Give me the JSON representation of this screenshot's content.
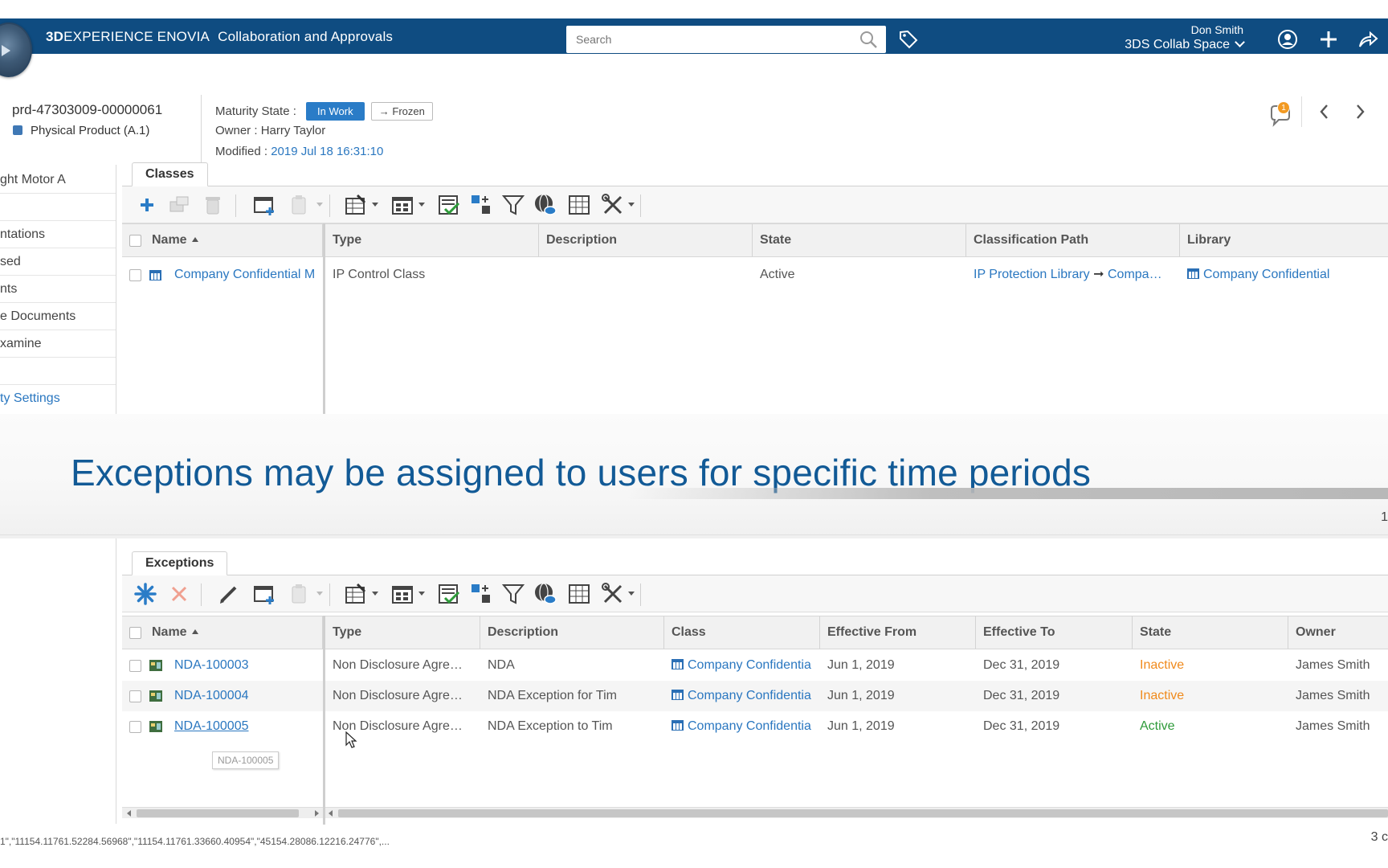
{
  "app": {
    "brand_bold": "3D",
    "brand_main": "EXPERIENCE ENOVIA",
    "brand_sub": "Collaboration and Approvals",
    "search_placeholder": "Search",
    "user_name": "Don Smith",
    "collab_space": "3DS Collab Space",
    "accent": "#0f4c81"
  },
  "header": {
    "object_id": "prd-47303009-00000061",
    "object_type": "Physical Product (A.1)",
    "maturity_label": "Maturity State :",
    "state_current": "In Work",
    "state_next": "Frozen",
    "owner_label": "Owner :",
    "owner_value": "Harry Taylor",
    "modified_label": "Modified :",
    "modified_value": "2019 Jul 18 16:31:10",
    "notification_count": "1"
  },
  "leftnav": {
    "items": [
      "ght Motor A",
      "ntations",
      "sed",
      "nts",
      "e Documents",
      "xamine",
      "ty Settings"
    ]
  },
  "classes": {
    "tab_label": "Classes",
    "columns": [
      "Name",
      "Type",
      "Description",
      "State",
      "Classification Path",
      "Library"
    ],
    "rows": [
      {
        "name": "Company Confidential M",
        "type": "IP Control Class",
        "description": "",
        "state": "Active",
        "path_from": "IP Protection Library",
        "path_to": "Compa…",
        "library": "Company Confidential"
      }
    ]
  },
  "banner": {
    "text": "Exceptions may be assigned to users for specific time periods",
    "page_number": "1"
  },
  "exceptions": {
    "tab_label": "Exceptions",
    "columns": [
      "Name",
      "Type",
      "Description",
      "Class",
      "Effective From",
      "Effective To",
      "State",
      "Owner"
    ],
    "rows": [
      {
        "name": "NDA-100003",
        "type": "Non Disclosure Agre…",
        "description": "NDA",
        "class": "Company Confidentia",
        "from": "Jun 1, 2019",
        "to": "Dec 31, 2019",
        "state": "Inactive",
        "owner": "James Smith"
      },
      {
        "name": "NDA-100004",
        "type": "Non Disclosure Agre…",
        "description": "NDA Exception for Tim",
        "class": "Company Confidentia",
        "from": "Jun 1, 2019",
        "to": "Dec 31, 2019",
        "state": "Inactive",
        "owner": "James Smith"
      },
      {
        "name": "NDA-100005",
        "type": "Non Disclosure Agre…",
        "description": "NDA Exception to Tim",
        "class": "Company Confidentia",
        "from": "Jun 1, 2019",
        "to": "Dec 31, 2019",
        "state": "Active",
        "owner": "James Smith"
      }
    ],
    "tooltip": "NDA-100005"
  },
  "statusbar": {
    "text": "1\",\"11154.11761.52284.56968\",\"11154.11761.33660.40954\",\"45154.28086.12216.24776\",...",
    "count": "3 c"
  },
  "colors": {
    "inactive": "#f08a1c",
    "active": "#2e9b3a",
    "link": "#2a77c0",
    "banner_text": "#125a96"
  }
}
